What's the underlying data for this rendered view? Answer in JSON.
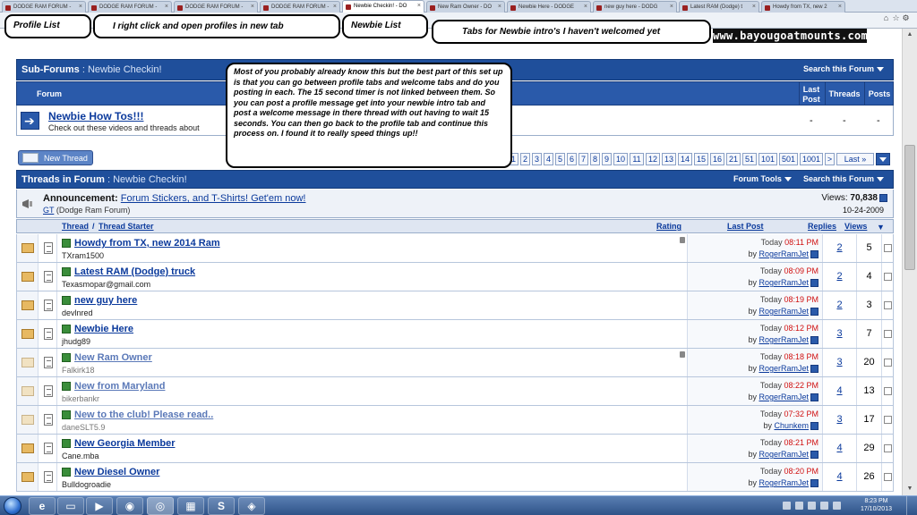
{
  "browser": {
    "tabs": [
      {
        "label": "DODGE RAM FORUM -"
      },
      {
        "label": "DODGE RAM FORUM -"
      },
      {
        "label": "DODGE RAM FORUM -"
      },
      {
        "label": "DODGE RAM FORUM -"
      },
      {
        "label": "Newbie Checkin! - DO"
      },
      {
        "label": "New Ram Owner - DO"
      },
      {
        "label": "Newbie Here - DODGE"
      },
      {
        "label": "new guy here - DODG"
      },
      {
        "label": "Latest RAM (Dodge) t"
      },
      {
        "label": "Howdy from TX, new 2"
      }
    ]
  },
  "banner": {
    "text": "www.bayougoatmounts.com"
  },
  "callouts": {
    "profile_list": "Profile List",
    "right_click": "I right click and open profiles in new tab",
    "newbie_list": "Newbie List",
    "tabs_note": "Tabs for Newbie intro's I haven't welcomed yet",
    "main_note": "Most of you probably already know this but the best part of this set up is that you can go between profile tabs and welcome tabs and do you posting in each.  The 15 second timer is not linked between them.  So you can post a profile message get into your newbie intro tab and post a welcome message in there thread with out having to wait 15 seconds.  You can then go back to the profile tab and continue this process on.  I found it to really speed things up!!"
  },
  "subforums": {
    "title": "Sub-Forums",
    "subtitle": ": Newbie Checkin!",
    "search_label": "Search this Forum",
    "col_forum": "Forum",
    "col_last_post_1": "Last",
    "col_last_post_2": "Post",
    "col_threads": "Threads",
    "col_posts": "Posts",
    "forum_name": "Newbie How Tos!!!",
    "forum_desc": "Check out these videos and threads about",
    "dash": "-"
  },
  "toolbar": {
    "new_thread": "New Thread",
    "pages": [
      "1",
      "2",
      "3",
      "4",
      "5",
      "6",
      "7",
      "8",
      "9",
      "10",
      "11",
      "12",
      "13",
      "14",
      "15",
      "16",
      "21",
      "51",
      "101",
      "501",
      "1001",
      ">",
      "Last »"
    ]
  },
  "threads_header": {
    "title": "Threads in Forum",
    "subtitle": ": Newbie Checkin!",
    "tools": "Forum Tools",
    "search": "Search this Forum"
  },
  "announcement": {
    "prefix": "Announcement:",
    "link": "Forum Stickers, and T-Shirts! Get'em now!",
    "author": "GT",
    "forum": "(Dodge Ram Forum)",
    "views_label": "Views:",
    "views": "70,838",
    "date": "10-24-2009"
  },
  "columns": {
    "thread": "Thread",
    "sep": "/",
    "starter": "Thread Starter",
    "rating": "Rating",
    "last_post": "Last Post",
    "replies": "Replies",
    "views": "Views"
  },
  "threads": [
    {
      "title": "Howdy from TX, new 2014 Ram",
      "starter": "TXram1500",
      "day": "Today",
      "time": "08:11 PM",
      "by": "by",
      "user": "RogerRamJet",
      "replies": "2",
      "views": "5",
      "read": false
    },
    {
      "title": "Latest RAM (Dodge) truck",
      "starter": "Texasmopar@gmail.com",
      "day": "Today",
      "time": "08:09 PM",
      "by": "by",
      "user": "RogerRamJet",
      "replies": "2",
      "views": "4",
      "read": false
    },
    {
      "title": "new guy here",
      "starter": "devlnred",
      "day": "Today",
      "time": "08:19 PM",
      "by": "by",
      "user": "RogerRamJet",
      "replies": "2",
      "views": "3",
      "read": false
    },
    {
      "title": "Newbie Here",
      "starter": "jhudg89",
      "day": "Today",
      "time": "08:12 PM",
      "by": "by",
      "user": "RogerRamJet",
      "replies": "3",
      "views": "7",
      "read": false
    },
    {
      "title": "New Ram Owner",
      "starter": "Falkirk18",
      "day": "Today",
      "time": "08:18 PM",
      "by": "by",
      "user": "RogerRamJet",
      "replies": "3",
      "views": "20",
      "read": true
    },
    {
      "title": "New from Maryland",
      "starter": "bikerbankr",
      "day": "Today",
      "time": "08:22 PM",
      "by": "by",
      "user": "RogerRamJet",
      "replies": "4",
      "views": "13",
      "read": true
    },
    {
      "title": "New to the club! Please read..",
      "starter": "daneSLT5.9",
      "day": "Today",
      "time": "07:32 PM",
      "by": "by",
      "user": "Chunkem",
      "replies": "3",
      "views": "17",
      "read": true
    },
    {
      "title": "New Georgia Member",
      "starter": "Cane.mba",
      "day": "Today",
      "time": "08:21 PM",
      "by": "by",
      "user": "RogerRamJet",
      "replies": "4",
      "views": "29",
      "read": false
    },
    {
      "title": "New Diesel Owner",
      "starter": "Bulldogroadie",
      "day": "Today",
      "time": "08:20 PM",
      "by": "by",
      "user": "RogerRamJet",
      "replies": "4",
      "views": "26",
      "read": false
    }
  ],
  "taskbar": {
    "clock_time": "8:23 PM",
    "clock_date": "17/10/2013"
  }
}
